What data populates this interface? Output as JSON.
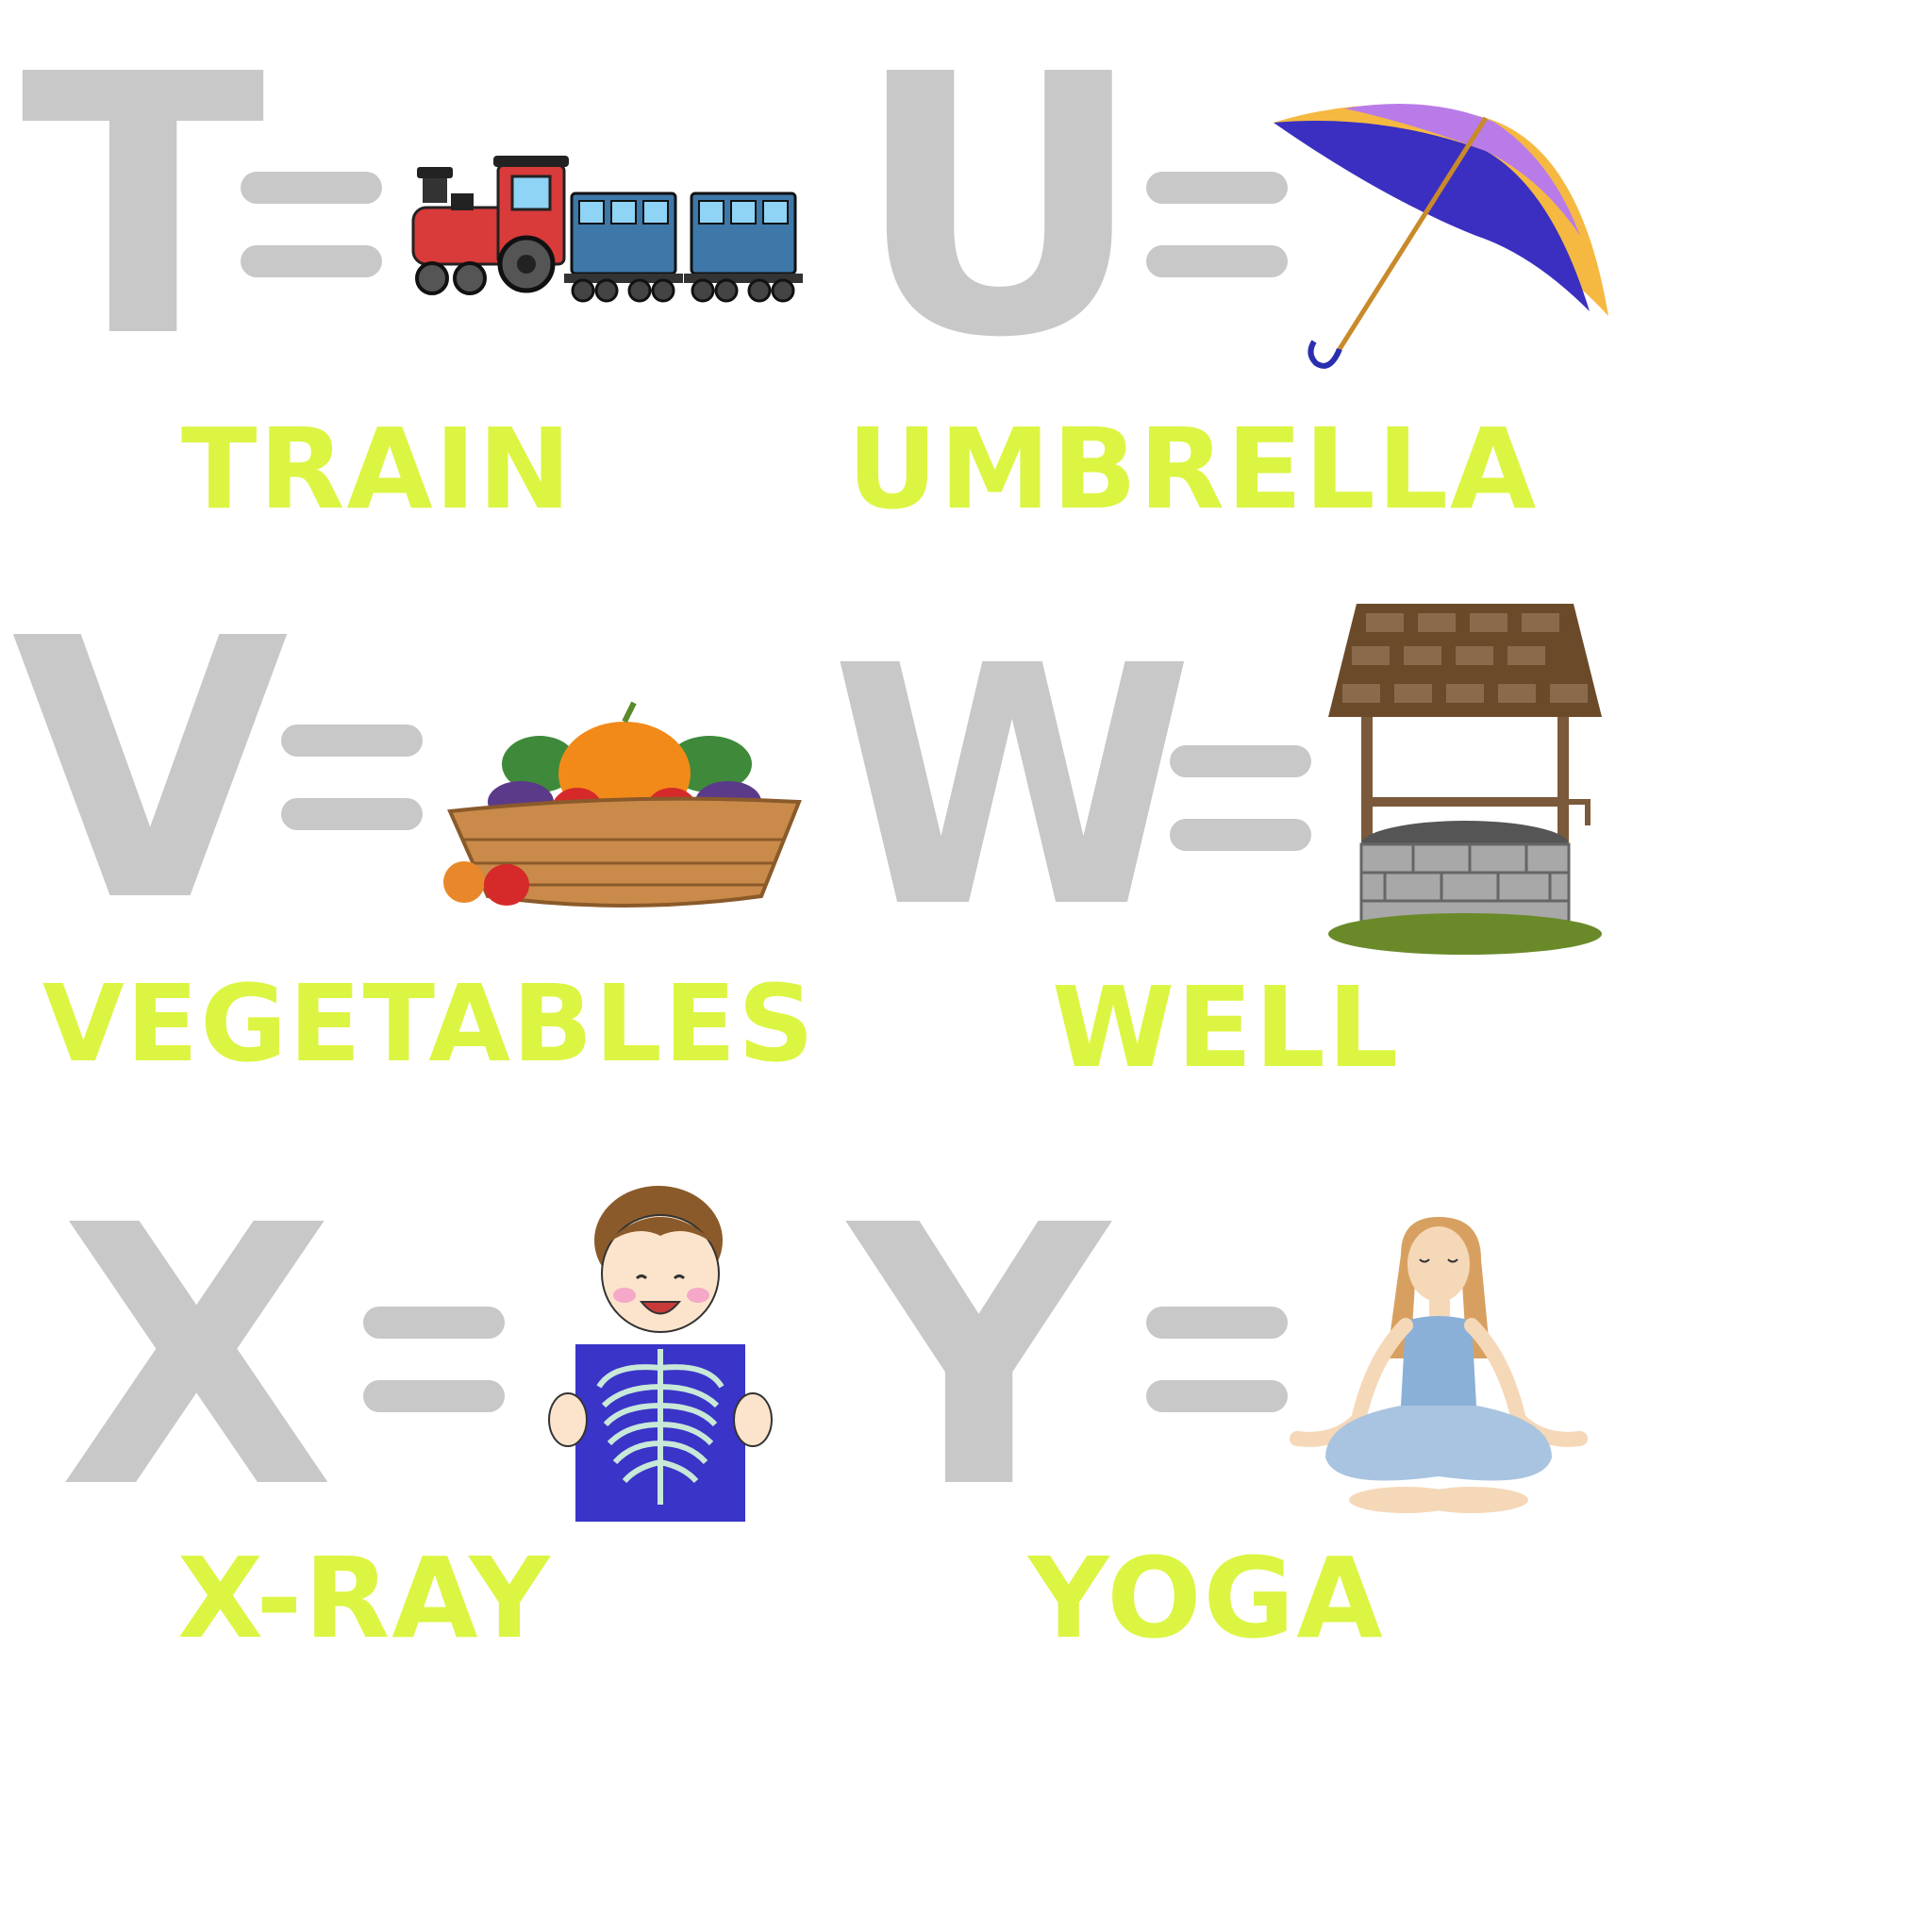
{
  "cards": [
    {
      "letter": "T",
      "word": "TRAIN",
      "picture": "train-picture"
    },
    {
      "letter": "U",
      "word": "UMBRELLA",
      "picture": "umbrella-picture"
    },
    {
      "letter": "V",
      "word": "VEGETABLES",
      "picture": "vegetable-basket-picture"
    },
    {
      "letter": "W",
      "word": "WELL",
      "picture": "wishing-well-picture"
    },
    {
      "letter": "X",
      "word": "X-RAY",
      "picture": "xray-boy-picture"
    },
    {
      "letter": "Y",
      "word": "YOGA",
      "picture": "yoga-woman-picture"
    }
  ],
  "colors": {
    "letter": "#c8c8c8",
    "word": "#dcf542",
    "background": "#ffffff"
  }
}
